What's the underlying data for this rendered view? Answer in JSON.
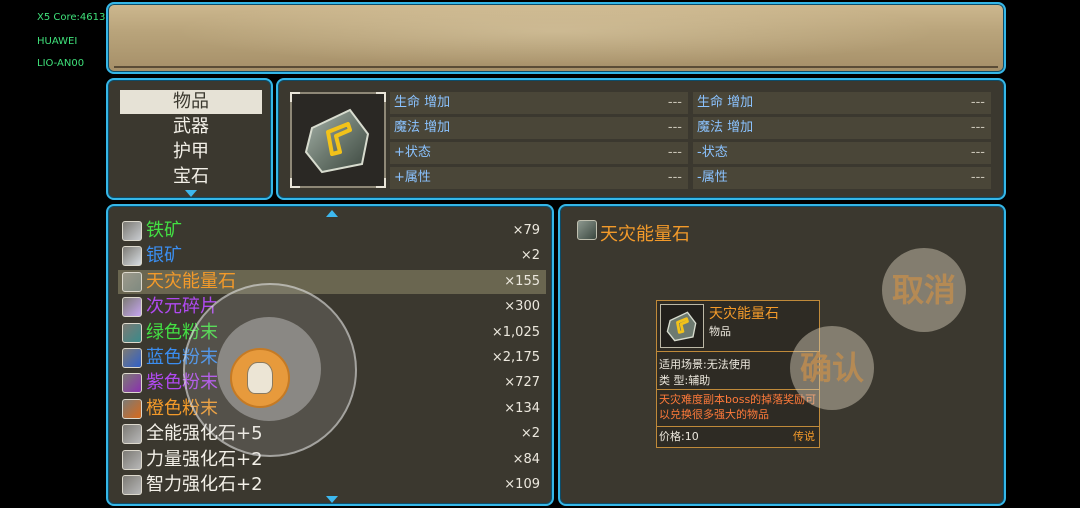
{
  "debug": [
    "X5 Core:4613",
    "HUAWEI",
    "LIO-AN00"
  ],
  "categories": [
    {
      "label": "物品",
      "selected": true
    },
    {
      "label": "武器",
      "selected": false
    },
    {
      "label": "护甲",
      "selected": false
    },
    {
      "label": "宝石",
      "selected": false
    }
  ],
  "stats": {
    "left": [
      {
        "label": "生命 增加",
        "value": "---"
      },
      {
        "label": "魔法 增加",
        "value": "---"
      },
      {
        "label": "+状态",
        "value": "---"
      },
      {
        "label": "+属性",
        "value": "---"
      }
    ],
    "right": [
      {
        "label": "生命 增加",
        "value": "---"
      },
      {
        "label": "魔法 增加",
        "value": "---"
      },
      {
        "label": "-状态",
        "value": "---"
      },
      {
        "label": "-属性",
        "value": "---"
      }
    ]
  },
  "items": [
    {
      "name": "铁矿",
      "qty": "×79",
      "color": "#43e043",
      "icon": "iron-ore-icon",
      "iconColor": "#c9ccd0",
      "selected": false
    },
    {
      "name": "银矿",
      "qty": "×2",
      "color": "#3b8ef0",
      "icon": "silver-ore-icon",
      "iconColor": "#d8dde2",
      "selected": false
    },
    {
      "name": "天灾能量石",
      "qty": "×155",
      "color": "#f39a2a",
      "icon": "calamity-stone-icon",
      "iconColor": "#7f8a80",
      "selected": true
    },
    {
      "name": "次元碎片",
      "qty": "×300",
      "color": "#b04af0",
      "icon": "dimension-shard-icon",
      "iconColor": "#c6a6f0",
      "selected": false
    },
    {
      "name": "绿色粉末",
      "qty": "×1,025",
      "color": "#43e043",
      "icon": "green-powder-icon",
      "iconColor": "#3a8a8a",
      "selected": false
    },
    {
      "name": "蓝色粉末",
      "qty": "×2,175",
      "color": "#3b8ef0",
      "icon": "blue-powder-icon",
      "iconColor": "#3060c8",
      "selected": false
    },
    {
      "name": "紫色粉末",
      "qty": "×727",
      "color": "#b04af0",
      "icon": "purple-powder-icon",
      "iconColor": "#8a30b0",
      "selected": false
    },
    {
      "name": "橙色粉末",
      "qty": "×134",
      "color": "#f39a2a",
      "icon": "orange-powder-icon",
      "iconColor": "#d86a1c",
      "selected": false
    },
    {
      "name": "全能强化石+5",
      "qty": "×2",
      "color": "#f3f0e8",
      "icon": "omni-enhance-stone-icon",
      "iconColor": "#b8b8b8",
      "selected": false
    },
    {
      "name": "力量强化石+2",
      "qty": "×84",
      "color": "#f3f0e8",
      "icon": "strength-enhance-stone-icon",
      "iconColor": "#b8b8b8",
      "selected": false
    },
    {
      "name": "智力强化石+2",
      "qty": "×109",
      "color": "#f3f0e8",
      "icon": "intellect-enhance-stone-icon",
      "iconColor": "#b8b8b8",
      "selected": false
    }
  ],
  "detail": {
    "title": "天灾能量石",
    "tooltip": {
      "name": "天灾能量石",
      "type": "物品",
      "scene": "适用场景:无法使用",
      "kind": "类    型:辅助",
      "desc": "天灾难度副本boss的掉落奖励可以兑换很多强大的物品",
      "price": "价格:10",
      "rarity": "传说"
    },
    "cancel_label": "取消",
    "confirm_label": "确认"
  }
}
